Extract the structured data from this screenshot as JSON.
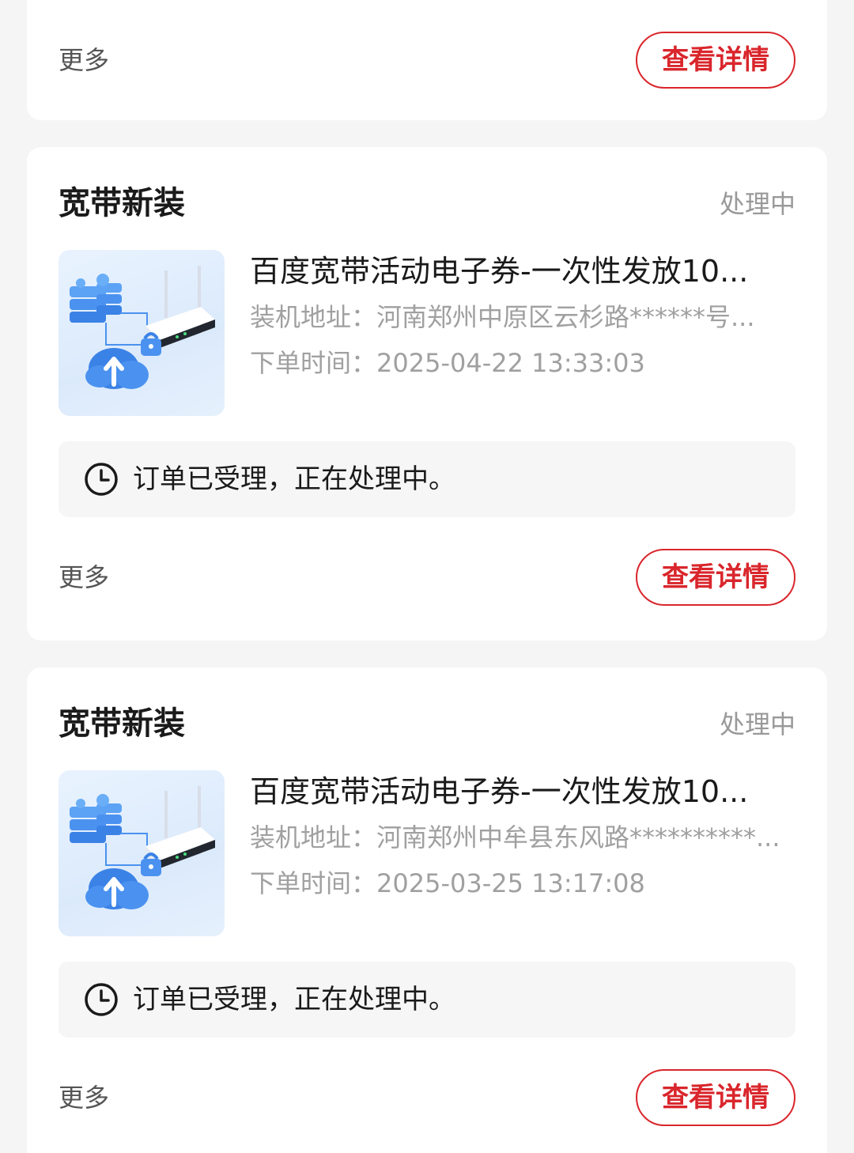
{
  "colors": {
    "accent": "#d9262c",
    "page_bg": "#f5f5f5",
    "card_bg": "#ffffff",
    "muted_text": "#999999"
  },
  "top_card": {
    "more_label": "更多",
    "detail_button": "查看详情"
  },
  "orders": [
    {
      "title": "宽带新装",
      "status": "处理中",
      "product_name": "百度宽带活动电子券-一次性发放10...",
      "image_icon": "broadband-router-cloud-illustration",
      "address_line": "装机地址：河南郑州中原区云杉路******号...",
      "order_time_line": "下单时间：2025-04-22 13:33:03",
      "progress_icon": "clock-icon",
      "progress_text": "订单已受理，正在处理中。",
      "more_label": "更多",
      "detail_button": "查看详情"
    },
    {
      "title": "宽带新装",
      "status": "处理中",
      "product_name": "百度宽带活动电子券-一次性发放10...",
      "image_icon": "broadband-router-cloud-illustration",
      "address_line": "装机地址：河南郑州中牟县东风路**********...",
      "order_time_line": "下单时间：2025-03-25 13:17:08",
      "progress_icon": "clock-icon",
      "progress_text": "订单已受理，正在处理中。",
      "more_label": "更多",
      "detail_button": "查看详情"
    }
  ]
}
